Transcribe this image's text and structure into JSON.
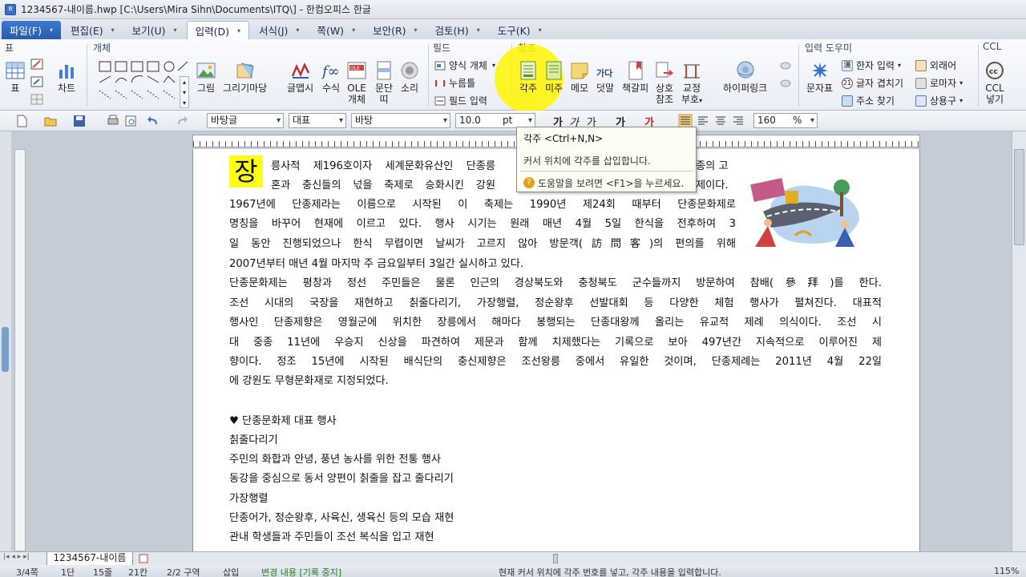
{
  "window": {
    "title": "1234567-내이름.hwp [C:\\Users\\Mira Sihn\\Documents\\ITQ\\] - 한컴오피스 한글"
  },
  "menu": {
    "file": "파일(F)",
    "tabs": [
      "편집(E)",
      "보기(U)",
      "입력(D)",
      "서식(J)",
      "쪽(W)",
      "보안(R)",
      "검토(H)",
      "도구(K)"
    ]
  },
  "ribbon": {
    "groups": {
      "table": "표",
      "object": "개체",
      "field": "필드",
      "reference": "참조",
      "input_helper": "입력 도우미",
      "ccl": "CCL"
    },
    "buttons": {
      "table": "표",
      "chart": "차트",
      "picture": "그림",
      "gallery": "그리기마당",
      "glyph": "글맵시",
      "formula": "수식",
      "ole_1": "OLE",
      "ole_2": "개체",
      "para_1": "문단",
      "para_2": "띠",
      "sound": "소리",
      "footnote": "각주",
      "endnote": "미주",
      "memo": "메모",
      "overwrite": "덧말",
      "bookmark": "책갈피",
      "cross_1": "상호",
      "cross_2": "참조",
      "proof_1": "교정",
      "proof_2": "부호",
      "hyperlink": "하이퍼링크",
      "charmap": "문자표",
      "ccl_1": "CCL",
      "ccl_2": "넣기"
    },
    "field_items": [
      "양식 개체",
      "누름틀",
      "필드 입력"
    ],
    "helper_items": [
      "한자 입력",
      "글자 겹치기",
      "주소 찾기"
    ],
    "helper_items2": [
      "외래어",
      "로마자",
      "상용구"
    ],
    "ccl_hanja_glyph": "가다"
  },
  "format": {
    "style": "바탕글",
    "lang": "대표",
    "font": "바탕",
    "size": "10.0",
    "unit": "pt",
    "glyphs": [
      "가",
      "가",
      "가",
      "가",
      "가"
    ],
    "zoom": "160",
    "zoom_unit": "%"
  },
  "tooltip": {
    "title": "각주 <Ctrl+N,N>",
    "desc": "커서 위치에 각주를 삽입합니다.",
    "help": "도움말을 보려면 <F1>을 누르세요."
  },
  "document": {
    "dropcap": "장",
    "lines": [
      "릉사적 제196호이자 세계문화유산인 단종릉",
      "혼과 충신들의 넋을 축제로 승화시킨 강원",
      "1967년에 단종제라는 이름으로 시작된 이 축제는 1990년 제24회 때부터 단종문화제로",
      "명칭을 바꾸어 현재에 이르고 있다. 행사 시기는 원래 매년 4월 5일 한식을 전후하여 3",
      "일 동안 진행되었으나 한식 무렵이면 날씨가 고르지 않아 방문객(訪問客)의 편의를 위해",
      "2007년부터 매년 4월 마지막 주 금요일부터 3일간 실시하고 있다.",
      "   단종문화제는 평창과 정선 주민들은 물론 인근의 경상북도와 충청북도 군수들까지 방문하여 참배(參拜)를 한다.",
      "조선 시대의 국장을 재현하고 칡줄다리기, 가장행렬, 정순왕후 선발대회 등 다양한 체험 행사가 펼쳐진다. 대표적",
      "행사인 단종제향은 영월군에 위치한 장릉에서 해마다 봉행되는 단종대왕께 올리는 유교적 제례 의식이다. 조선 시",
      "대 중종 11년에 우승지 신상을 파견하여 제문과 함께 치제했다는 기록으로 보아 497년간 지속적으로 이루어진 제",
      "향이다. 정조 15년에 시작된 배식단의 충신제향은 조선왕릉 중에서 유일한 것이며, 단종제례는 2011년 4월 22일",
      "에 강원도 무형문화재로 지정되었다."
    ],
    "line1_tail": "종의 고",
    "line2_tail": "제이다.",
    "section_title": "♥ 단종문화제 대표 행사",
    "list": [
      "칡줄다리기",
      "주민의 화합과 안녕, 풍년 농사를 위한 전통 행사",
      "동강을 중심으로 동서 양편이 칡줄을 잡고 줄다리기",
      "가장행렬",
      "단종어가, 정순왕후, 사육신, 생육신 등의 모습 재현",
      "관내 학생들과 주민들이 조선 복식을 입고 재현"
    ]
  },
  "bottom": {
    "doc_tab": "1234567-내이름",
    "status": {
      "page": "3/4쪽",
      "col": "1단",
      "line": "15줄",
      "char": "21칸",
      "section": "2/2 구역",
      "mode": "삽입",
      "track": "변경 내용 [기록 중지]",
      "message": "현재 커서 위치에 각주 번호를 넣고, 각주 내용을 입력합니다.",
      "zoom": "115%"
    }
  },
  "colors": {
    "accent": "#2f67be",
    "highlight": "#ffff1a",
    "tooltip_bg": "#fdfdf4"
  }
}
